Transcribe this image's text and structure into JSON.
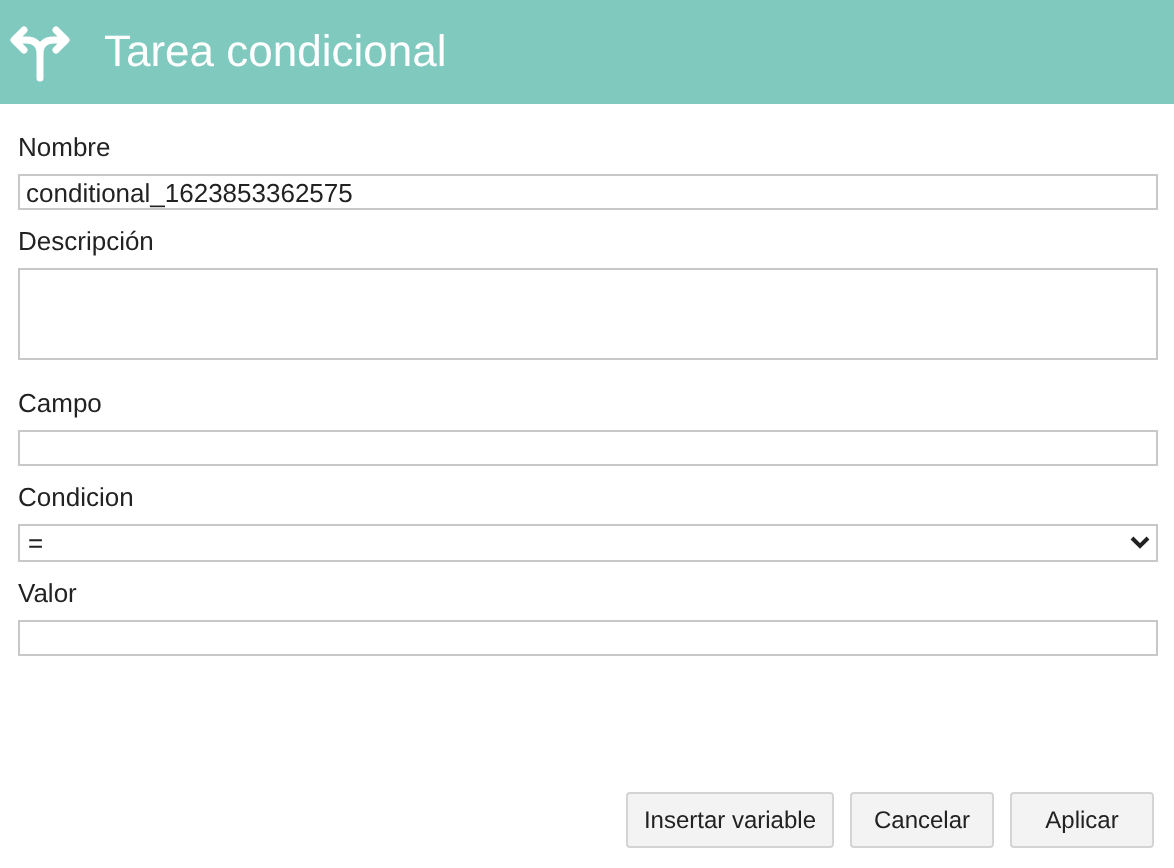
{
  "header": {
    "title": "Tarea condicional"
  },
  "fields": [
    {
      "label": "Nombre",
      "kind": "text",
      "value": "conditional_1623853362575"
    },
    {
      "label": "Descripción",
      "kind": "textarea"
    },
    {
      "label": "Campo",
      "kind": "text"
    },
    {
      "label": "Condicion",
      "kind": "select",
      "value": "="
    },
    {
      "label": "Valor",
      "kind": "text"
    }
  ],
  "buttons": [
    "Insertar variable",
    "Cancelar",
    "Aplicar"
  ]
}
